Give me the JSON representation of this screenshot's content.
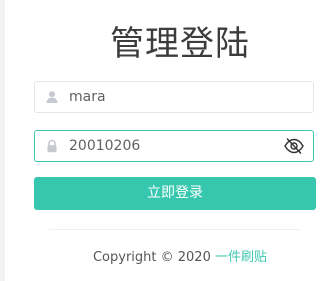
{
  "login": {
    "title": "管理登陆",
    "username": {
      "value": "mara",
      "icon": "user-icon"
    },
    "password": {
      "value": "20010206",
      "icon": "lock-icon",
      "toggle_icon": "eye-slash-icon"
    },
    "submit_label": "立即登录"
  },
  "footer": {
    "copyright": "Copyright © 2020",
    "link_text": "一件刷贴"
  },
  "colors": {
    "accent": "#37c7ae",
    "focus_border": "#3ec7ae",
    "title": "#3c3c3c"
  }
}
